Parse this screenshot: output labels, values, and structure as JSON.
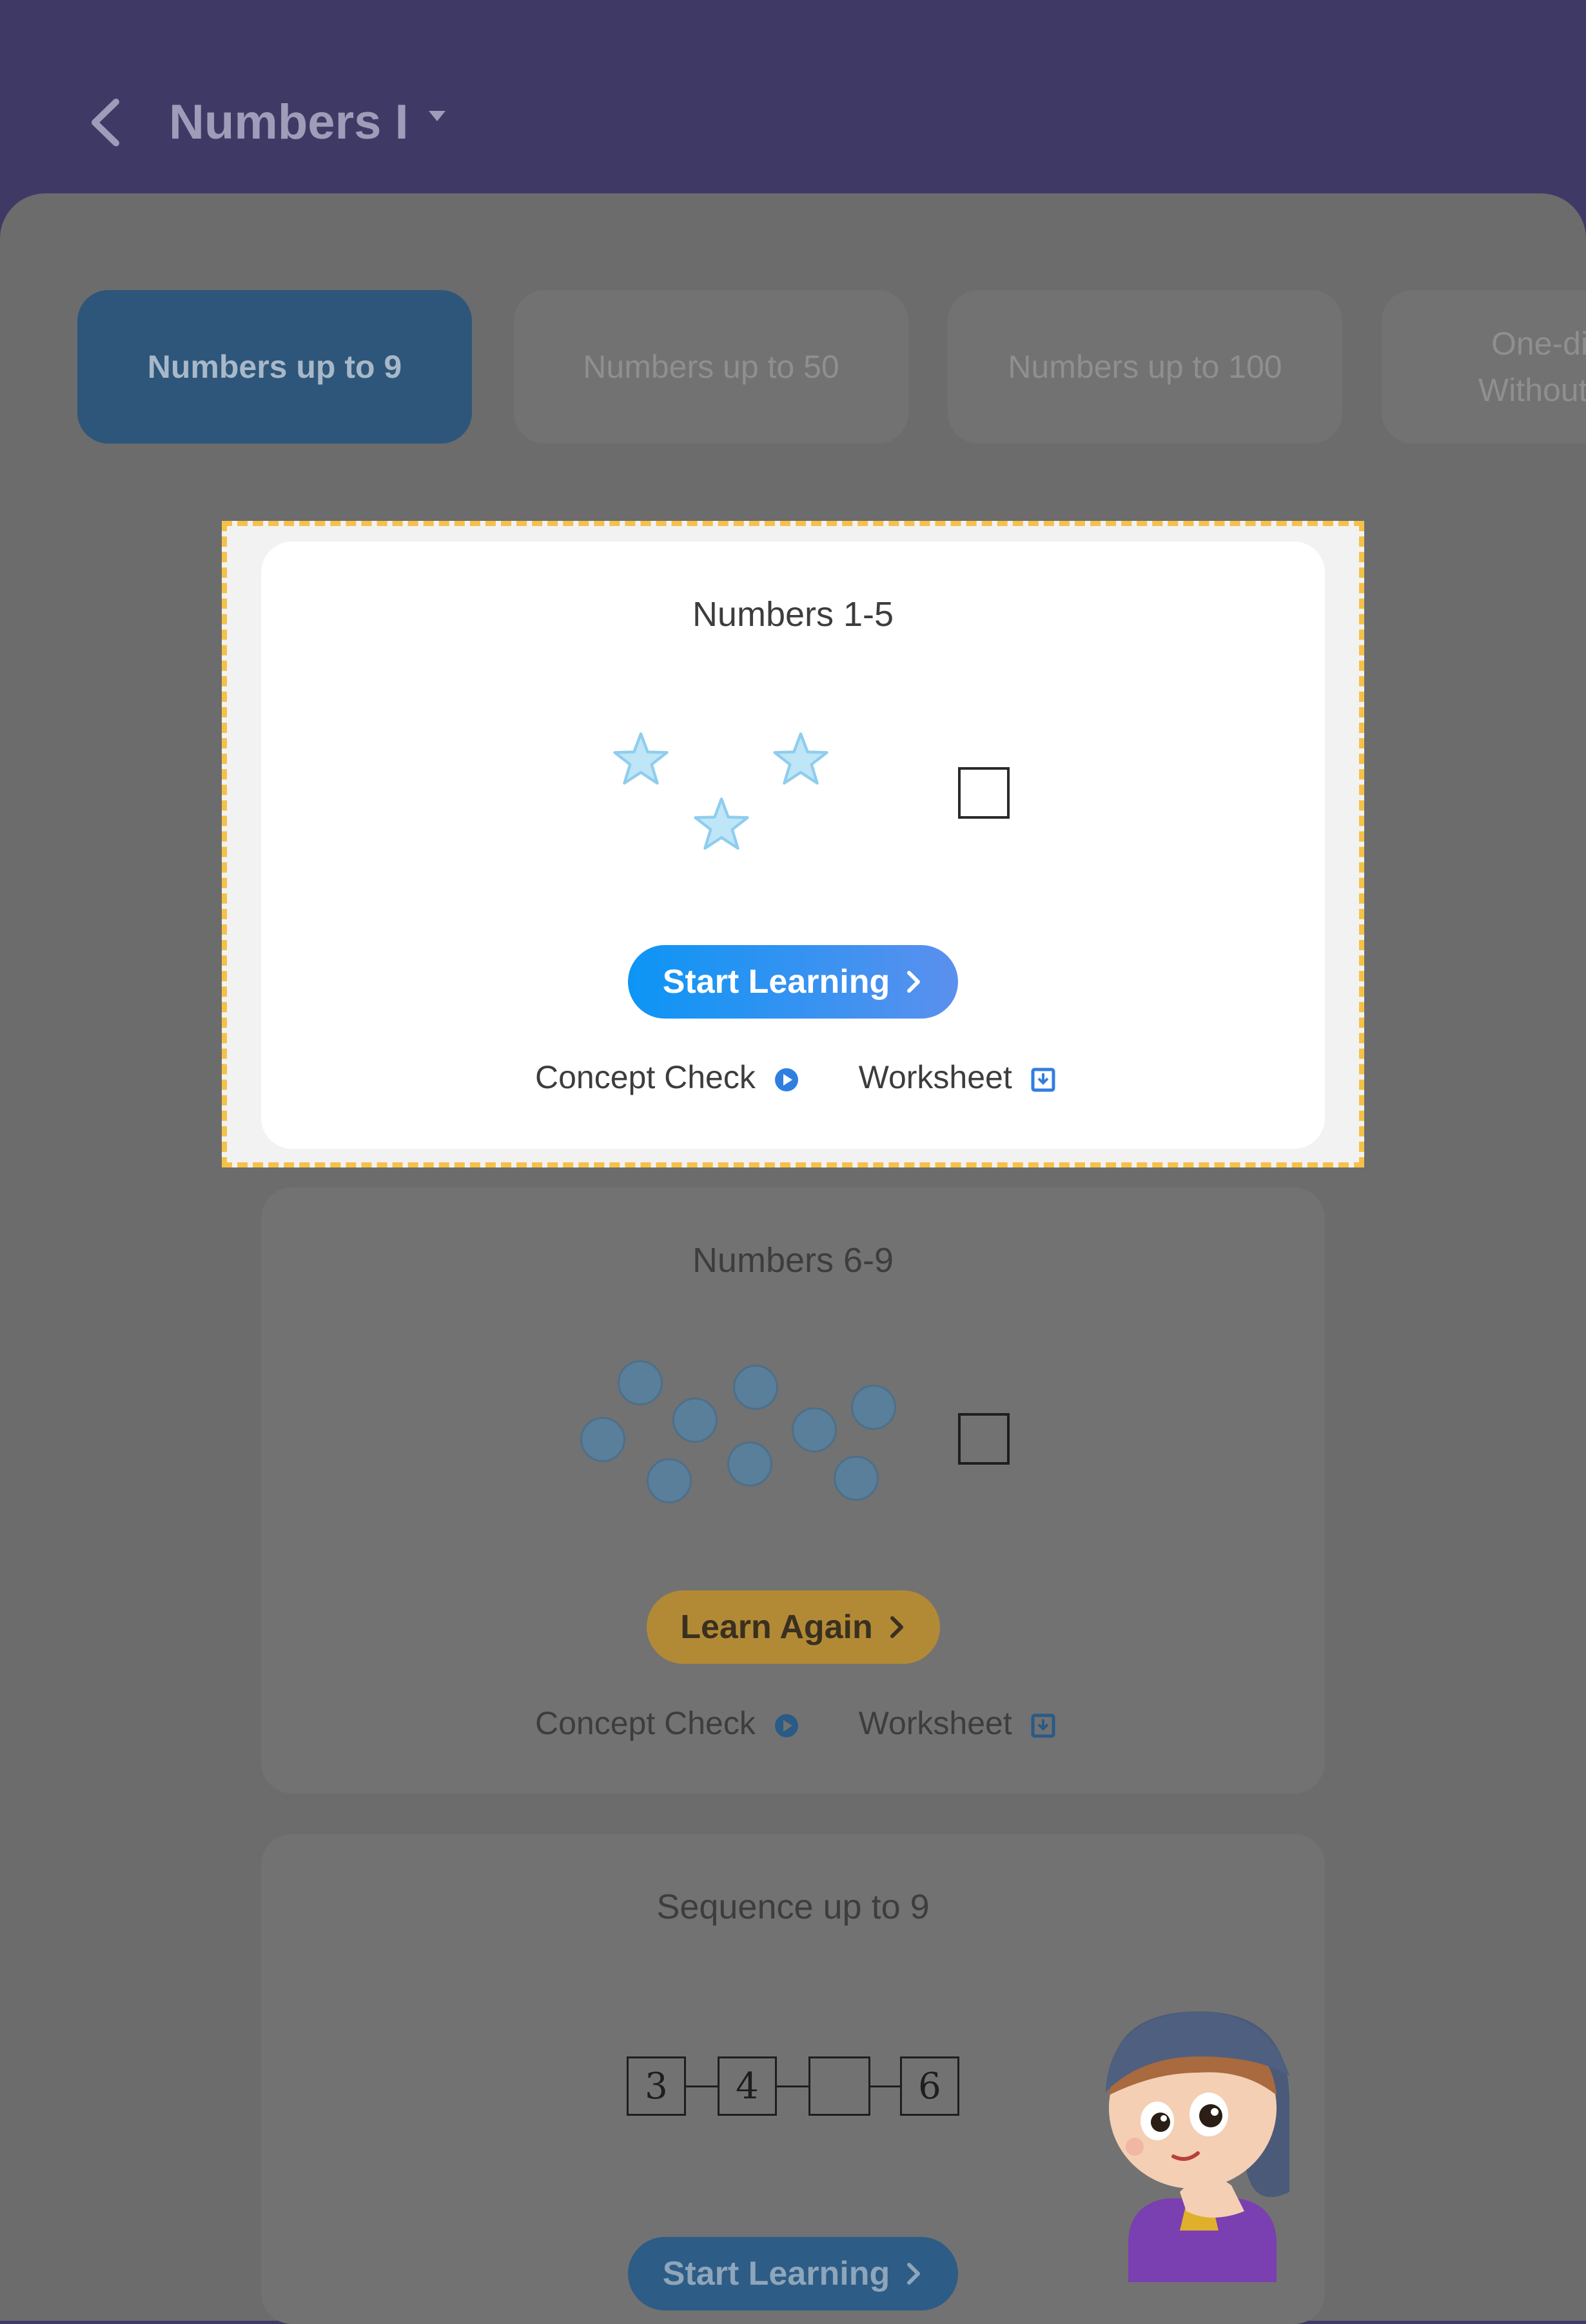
{
  "header": {
    "title": "Numbers I"
  },
  "tabs": [
    {
      "label": "Numbers up to 9"
    },
    {
      "label": "Numbers up to 50"
    },
    {
      "label": "Numbers up to 100"
    },
    {
      "label_line1": "One-digit",
      "label_line2": "Without Re"
    }
  ],
  "lessons": [
    {
      "title": "Numbers 1-5",
      "button": "Start Learning",
      "concept_check": "Concept Check",
      "worksheet": "Worksheet"
    },
    {
      "title": "Numbers 6-9",
      "button": "Learn Again",
      "concept_check": "Concept Check",
      "worksheet": "Worksheet"
    },
    {
      "title": "Sequence up to 9",
      "button": "Start Learning",
      "sequence": [
        "3",
        "4",
        "",
        "6"
      ]
    }
  ],
  "colors": {
    "accent": "#f6c148",
    "primary_button": "#1f96f3",
    "learn_again": "#b28a36"
  }
}
